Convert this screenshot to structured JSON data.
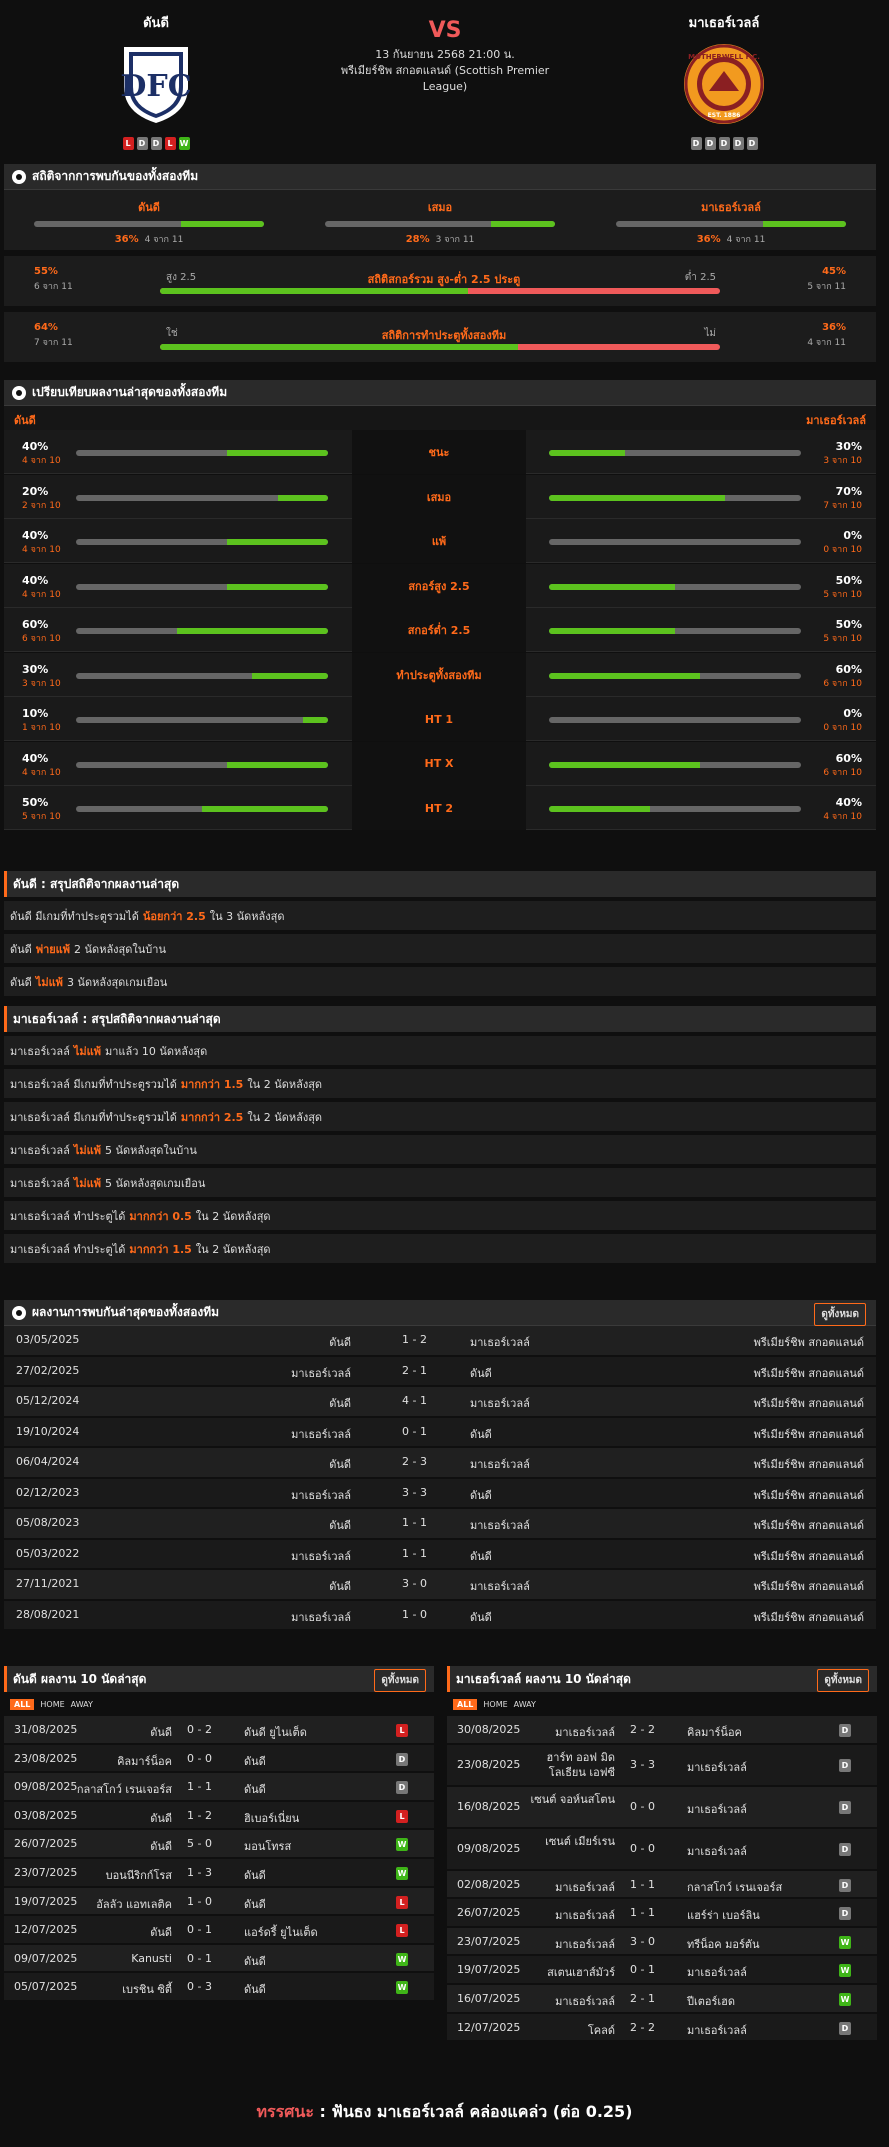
{
  "header": {
    "home": "ดันดี",
    "away": "มาเธอร์เวลล์",
    "vs": "VS",
    "date": "13 กันยายน 2568 21:00 น.",
    "league": "พรีเมียร์ชิพ สกอตแลนด์ (Scottish Premier League)",
    "home_form": [
      "L",
      "D",
      "D",
      "L",
      "W"
    ],
    "away_form": [
      "D",
      "D",
      "D",
      "D",
      "D"
    ],
    "away_logo_text": "MOTHERWELL F.C.",
    "away_logo_est": "EST. 1886"
  },
  "h2h": {
    "title": "สถิติจากการพบกันของทั้งสองทีม",
    "cells": [
      {
        "label": "ดันดี",
        "pct": "36%",
        "sub": "4 จาก 11",
        "fill": 36
      },
      {
        "label": "เสมอ",
        "pct": "28%",
        "sub": "3 จาก 11",
        "fill": 28
      },
      {
        "label": "มาเธอร์เวลล์",
        "pct": "36%",
        "sub": "4 จาก 11",
        "fill": 36
      }
    ],
    "ou": {
      "label": "สถิติสกอร์รวม สูง-ต่ำ 2.5 ประตู",
      "lpct": "55%",
      "lsub": "6 จาก 11",
      "rpct": "45%",
      "rsub": "5 จาก 11",
      "ltag": "สูง 2.5",
      "rtag": "ต่ำ 2.5",
      "fill": 55
    },
    "btts": {
      "label": "สถิติการทำประตูทั้งสองทีม",
      "lpct": "64%",
      "lsub": "7 จาก 11",
      "rpct": "36%",
      "rsub": "4 จาก 11",
      "ltag": "ใช่",
      "rtag": "ไม่",
      "fill": 64
    }
  },
  "compare": {
    "title": "เปรียบเทียบผลงานล่าสุดของทั้งสองทีม",
    "home": "ดันดี",
    "away": "มาเธอร์เวลล์",
    "rows": [
      {
        "label": "ชนะ",
        "lp": "40%",
        "ls": "4 จาก 10",
        "lf": 40,
        "rp": "30%",
        "rs": "3 จาก 10",
        "rf": 30
      },
      {
        "label": "เสมอ",
        "lp": "20%",
        "ls": "2 จาก 10",
        "lf": 20,
        "rp": "70%",
        "rs": "7 จาก 10",
        "rf": 70
      },
      {
        "label": "แพ้",
        "lp": "40%",
        "ls": "4 จาก 10",
        "lf": 40,
        "rp": "0%",
        "rs": "0 จาก 10",
        "rf": 0
      },
      {
        "label": "สกอร์สูง 2.5",
        "lp": "40%",
        "ls": "4 จาก 10",
        "lf": 40,
        "rp": "50%",
        "rs": "5 จาก 10",
        "rf": 50
      },
      {
        "label": "สกอร์ต่ำ 2.5",
        "lp": "60%",
        "ls": "6 จาก 10",
        "lf": 60,
        "rp": "50%",
        "rs": "5 จาก 10",
        "rf": 50
      },
      {
        "label": "ทำประตูทั้งสองทีม",
        "lp": "30%",
        "ls": "3 จาก 10",
        "lf": 30,
        "rp": "60%",
        "rs": "6 จาก 10",
        "rf": 60
      },
      {
        "label": "HT 1",
        "lp": "10%",
        "ls": "1 จาก 10",
        "lf": 10,
        "rp": "0%",
        "rs": "0 จาก 10",
        "rf": 0
      },
      {
        "label": "HT X",
        "lp": "40%",
        "ls": "4 จาก 10",
        "lf": 40,
        "rp": "60%",
        "rs": "6 จาก 10",
        "rf": 60
      },
      {
        "label": "HT 2",
        "lp": "50%",
        "ls": "5 จาก 10",
        "lf": 50,
        "rp": "40%",
        "rs": "4 จาก 10",
        "rf": 40
      }
    ]
  },
  "sum_home": {
    "title": "ดันดี : สรุปสถิติจากผลงานล่าสุด",
    "rows": [
      [
        "ดันดี มีเกมที่ทำประตูรวมได้",
        "น้อยกว่า 2.5",
        "ใน 3 นัดหลังสุด"
      ],
      [
        "ดันดี",
        "พ่ายแพ้",
        "2 นัดหลังสุดในบ้าน"
      ],
      [
        "ดันดี",
        "ไม่แพ้",
        "3 นัดหลังสุดเกมเยือน"
      ]
    ]
  },
  "sum_away": {
    "title": "มาเธอร์เวลล์ : สรุปสถิติจากผลงานล่าสุด",
    "rows": [
      [
        "มาเธอร์เวลล์",
        "ไม่แพ้",
        "มาแล้ว 10 นัดหลังสุด"
      ],
      [
        "มาเธอร์เวลล์ มีเกมที่ทำประตูรวมได้",
        "มากกว่า 1.5",
        "ใน 2 นัดหลังสุด"
      ],
      [
        "มาเธอร์เวลล์ มีเกมที่ทำประตูรวมได้",
        "มากกว่า 2.5",
        "ใน 2 นัดหลังสุด"
      ],
      [
        "มาเธอร์เวลล์",
        "ไม่แพ้",
        "5 นัดหลังสุดในบ้าน"
      ],
      [
        "มาเธอร์เวลล์",
        "ไม่แพ้",
        "5 นัดหลังสุดเกมเยือน"
      ],
      [
        "มาเธอร์เวลล์ ทำประตูได้",
        "มากกว่า 0.5",
        "ใน 2 นัดหลังสุด"
      ],
      [
        "มาเธอร์เวลล์ ทำประตูได้",
        "มากกว่า 1.5",
        "ใน 2 นัดหลังสุด"
      ]
    ]
  },
  "meetings": {
    "title": "ผลงานการพบกันล่าสุดของทั้งสองทีม",
    "btn": "ดูทั้งหมด",
    "rows": [
      [
        "03/05/2025",
        "ดันดี",
        "1 - 2",
        "มาเธอร์เวลล์",
        "พรีเมียร์ชิพ สกอตแลนด์"
      ],
      [
        "27/02/2025",
        "มาเธอร์เวลล์",
        "2 - 1",
        "ดันดี",
        "พรีเมียร์ชิพ สกอตแลนด์"
      ],
      [
        "05/12/2024",
        "ดันดี",
        "4 - 1",
        "มาเธอร์เวลล์",
        "พรีเมียร์ชิพ สกอตแลนด์"
      ],
      [
        "19/10/2024",
        "มาเธอร์เวลล์",
        "0 - 1",
        "ดันดี",
        "พรีเมียร์ชิพ สกอตแลนด์"
      ],
      [
        "06/04/2024",
        "ดันดี",
        "2 - 3",
        "มาเธอร์เวลล์",
        "พรีเมียร์ชิพ สกอตแลนด์"
      ],
      [
        "02/12/2023",
        "มาเธอร์เวลล์",
        "3 - 3",
        "ดันดี",
        "พรีเมียร์ชิพ สกอตแลนด์"
      ],
      [
        "05/08/2023",
        "ดันดี",
        "1 - 1",
        "มาเธอร์เวลล์",
        "พรีเมียร์ชิพ สกอตแลนด์"
      ],
      [
        "05/03/2022",
        "มาเธอร์เวลล์",
        "1 - 1",
        "ดันดี",
        "พรีเมียร์ชิพ สกอตแลนด์"
      ],
      [
        "27/11/2021",
        "ดันดี",
        "3 - 0",
        "มาเธอร์เวลล์",
        "พรีเมียร์ชิพ สกอตแลนด์"
      ],
      [
        "28/08/2021",
        "มาเธอร์เวลล์",
        "1 - 0",
        "ดันดี",
        "พรีเมียร์ชิพ สกอตแลนด์"
      ]
    ]
  },
  "last_home": {
    "title": "ดันดี ผลงาน 10 นัดล่าสุด",
    "btn": "ดูทั้งหมด",
    "filters": [
      "ALL",
      "HOME",
      "AWAY"
    ],
    "rows": [
      [
        "31/08/2025",
        "ดันดี",
        "0 - 2",
        "ดันดี ยูไนเต็ด",
        "L"
      ],
      [
        "23/08/2025",
        "คิลมาร์น็อค",
        "0 - 0",
        "ดันดี",
        "D"
      ],
      [
        "09/08/2025",
        "กลาสโกว์ เรนเจอร์ส",
        "1 - 1",
        "ดันดี",
        "D"
      ],
      [
        "03/08/2025",
        "ดันดี",
        "1 - 2",
        "ฮิเบอร์เนี่ยน",
        "L"
      ],
      [
        "26/07/2025",
        "ดันดี",
        "5 - 0",
        "มอนโทรส",
        "W"
      ],
      [
        "23/07/2025",
        "บอนนีริกก์โรส",
        "1 - 3",
        "ดันดี",
        "W"
      ],
      [
        "19/07/2025",
        "อัลลัว แอทเลติค",
        "1 - 0",
        "ดันดี",
        "L"
      ],
      [
        "12/07/2025",
        "ดันดี",
        "0 - 1",
        "แอร์ดรี้ ยูไนเต็ด",
        "L"
      ],
      [
        "09/07/2025",
        "Kanusti",
        "0 - 1",
        "ดันดี",
        "W"
      ],
      [
        "05/07/2025",
        "เบรชิน ซิตี้",
        "0 - 3",
        "ดันดี",
        "W"
      ]
    ]
  },
  "last_away": {
    "title": "มาเธอร์เวลล์ ผลงาน 10 นัดล่าสุด",
    "btn": "ดูทั้งหมด",
    "filters": [
      "ALL",
      "HOME",
      "AWAY"
    ],
    "rows": [
      [
        "30/08/2025",
        "มาเธอร์เวลล์",
        "2 - 2",
        "คิลมาร์น็อค",
        "D"
      ],
      [
        "23/08/2025",
        "ฮาร์ท ออฟ มิด โลเธียน เอฟซี",
        "3 - 3",
        "มาเธอร์เวลล์",
        "D"
      ],
      [
        "16/08/2025",
        "เซนต์ จอห์นสโตน",
        "0 - 0",
        "มาเธอร์เวลล์",
        "D"
      ],
      [
        "09/08/2025",
        "เซนต์ เมียร์เรน",
        "0 - 0",
        "มาเธอร์เวลล์",
        "D"
      ],
      [
        "02/08/2025",
        "มาเธอร์เวลล์",
        "1 - 1",
        "กลาสโกว์ เรนเจอร์ส",
        "D"
      ],
      [
        "26/07/2025",
        "มาเธอร์เวลล์",
        "1 - 1",
        "แฮร์ร่า เบอร์ลิน",
        "D"
      ],
      [
        "23/07/2025",
        "มาเธอร์เวลล์",
        "3 - 0",
        "ทรีน็อค มอร์ตัน",
        "W"
      ],
      [
        "19/07/2025",
        "สเตนเฮาส์มัวร์",
        "0 - 1",
        "มาเธอร์เวลล์",
        "W"
      ],
      [
        "16/07/2025",
        "มาเธอร์เวลล์",
        "2 - 1",
        "ปีเตอร์เฮด",
        "W"
      ],
      [
        "12/07/2025",
        "โคลด์",
        "2 - 2",
        "มาเธอร์เวลล์",
        "D"
      ]
    ]
  },
  "verdict": {
    "label": "ทรรศนะ",
    "sep": ":",
    "text": "ฟันธง มาเธอร์เวลล์ คล่องแคล่ว (ต่อ 0.25)"
  },
  "colors": {
    "accent": "#ff6a1a",
    "win": "#3fb518",
    "loss": "#d32020",
    "draw": "#777777",
    "vs": "#f05a5a"
  }
}
